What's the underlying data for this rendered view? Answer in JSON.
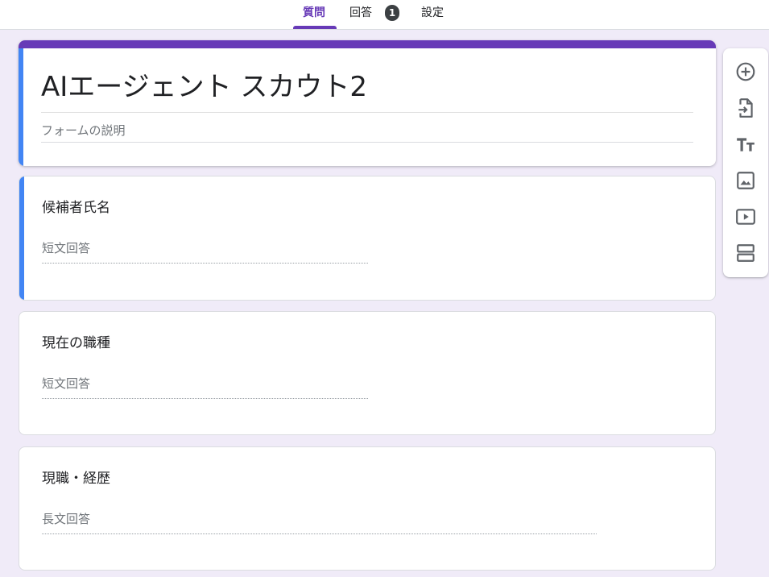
{
  "tabs": [
    {
      "label": "質問",
      "active": true
    },
    {
      "label": "回答",
      "badge": "1"
    },
    {
      "label": "設定"
    }
  ],
  "form": {
    "title": "AIエージェント スカウト2",
    "description_placeholder": "フォームの説明"
  },
  "questions": [
    {
      "title": "候補者氏名",
      "answer_type": "短文回答"
    },
    {
      "title": "現在の職種",
      "answer_type": "短文回答"
    },
    {
      "title": "現職・経歴",
      "answer_type": "長文回答"
    }
  ],
  "toolbar": {
    "icons": [
      "add-question-icon",
      "import-questions-icon",
      "add-title-icon",
      "add-image-icon",
      "add-video-icon",
      "add-section-icon"
    ]
  },
  "colors": {
    "accent": "#673ab7",
    "selected": "#4285f4",
    "background": "#f0ebf8",
    "icon": "#5f6368"
  }
}
